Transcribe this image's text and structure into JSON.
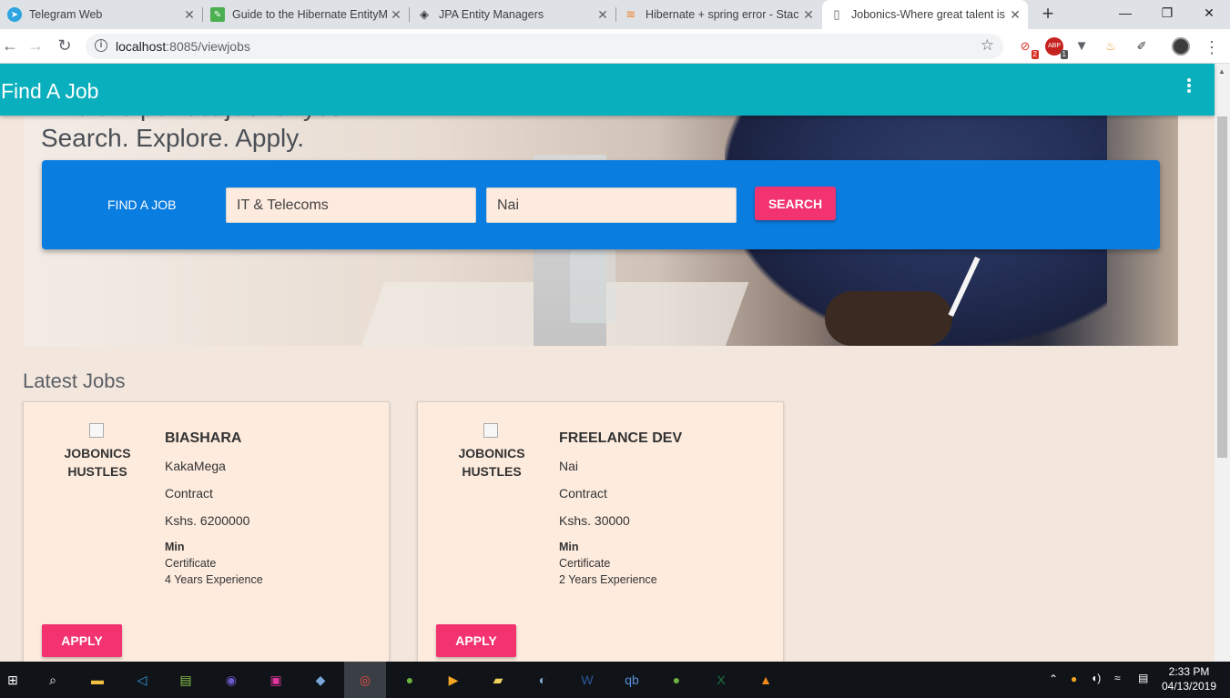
{
  "browser": {
    "tabs": [
      {
        "title": "Telegram Web",
        "icon": "telegram-icon",
        "color": "#2ca5e0"
      },
      {
        "title": "Guide to the Hibernate EntityM",
        "icon": "bookmark-icon",
        "color": "#4caf50"
      },
      {
        "title": "JPA Entity Managers",
        "icon": "diamond-icon",
        "color": "#333333"
      },
      {
        "title": "Hibernate + spring error - Stac",
        "icon": "stackoverflow-icon",
        "color": "#f48024"
      },
      {
        "title": "Jobonics-Where great talent is",
        "icon": "page-icon",
        "color": "#5f6368",
        "active": true
      }
    ],
    "new_tab": "+",
    "url_host": "localhost",
    "url_rest": ":8085/viewjobs",
    "extensions": [
      {
        "name": "ext-red-icon",
        "badge": "2"
      },
      {
        "name": "adblock-icon",
        "badge": "1"
      },
      {
        "name": "vue-icon",
        "badge": ""
      },
      {
        "name": "java-icon",
        "badge": ""
      },
      {
        "name": "eyedropper-icon",
        "badge": ""
      }
    ]
  },
  "page": {
    "brand": "Find A Job",
    "hero_line1": "Find the perfect job for you.",
    "hero_line2": "Search. Explore. Apply.",
    "search": {
      "label": "FIND A JOB",
      "category_value": "IT & Telecoms",
      "location_value": "Nai",
      "button": "SEARCH"
    },
    "section_title": "Latest Jobs",
    "jobs": [
      {
        "company_line1": "JOBONICS",
        "company_line2": "HUSTLES",
        "title": "BIASHARA",
        "location": "KakaMega",
        "type": "Contract",
        "salary": "Kshs. 6200000",
        "min_label": "Min",
        "education": "Certificate",
        "experience": "4 Years Experience",
        "apply": "APPLY"
      },
      {
        "company_line1": "JOBONICS",
        "company_line2": "HUSTLES",
        "title": "FREELANCE DEV",
        "location": "Nai",
        "type": "Contract",
        "salary": "Kshs. 30000",
        "min_label": "Min",
        "education": "Certificate",
        "experience": "2 Years Experience",
        "apply": "APPLY"
      }
    ]
  },
  "taskbar": {
    "time": "2:33 PM",
    "date": "04/13/2019"
  },
  "colors": {
    "appbar": "#0aafbd",
    "search_panel": "#0a7de0",
    "accent_button": "#f2336f",
    "card_bg": "#fdebde"
  }
}
